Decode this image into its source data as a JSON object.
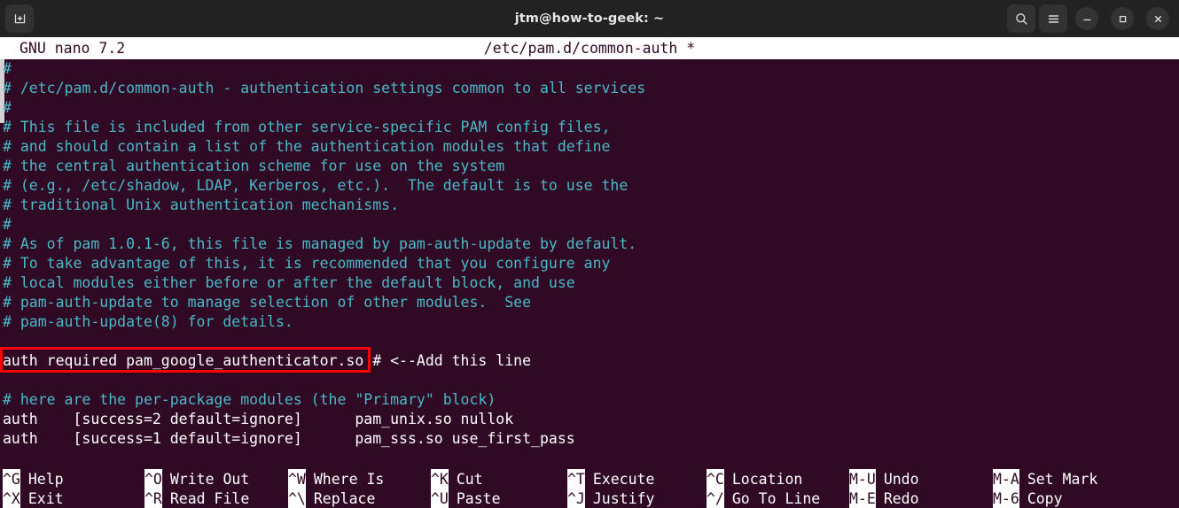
{
  "titlebar": {
    "title": "jtm@how-to-geek: ~",
    "new_tab_icon": "new-tab-icon",
    "search_icon": "search-icon",
    "menu_icon": "hamburger-menu-icon",
    "minimize_icon": "minimize-icon",
    "maximize_icon": "maximize-icon",
    "close_icon": "close-icon",
    "bg_color": "#222222"
  },
  "nano": {
    "version": "GNU nano 7.2",
    "filename": "/etc/pam.d/common-auth *",
    "header_bg": "#ffffff",
    "header_fg": "#300a24",
    "terminal_bg": "#300a24",
    "comment_color": "#48b9c7",
    "text_color": "#ffffff"
  },
  "editor": {
    "lines": [
      {
        "segments": [
          {
            "text": "#",
            "kind": "cmt"
          }
        ]
      },
      {
        "segments": [
          {
            "text": "# /etc/pam.d/common-auth - authentication settings common to all services",
            "kind": "cmt"
          }
        ]
      },
      {
        "segments": [
          {
            "text": "#",
            "kind": "cmt"
          }
        ]
      },
      {
        "segments": [
          {
            "text": "# This file is included from other service-specific PAM config files,",
            "kind": "cmt"
          }
        ]
      },
      {
        "segments": [
          {
            "text": "# and should contain a list of the authentication modules that define",
            "kind": "cmt"
          }
        ]
      },
      {
        "segments": [
          {
            "text": "# the central authentication scheme for use on the system",
            "kind": "cmt"
          }
        ]
      },
      {
        "segments": [
          {
            "text": "# (e.g., /etc/shadow, LDAP, Kerberos, etc.).  The default is to use the",
            "kind": "cmt"
          }
        ]
      },
      {
        "segments": [
          {
            "text": "# traditional Unix authentication mechanisms.",
            "kind": "cmt"
          }
        ]
      },
      {
        "segments": [
          {
            "text": "#",
            "kind": "cmt"
          }
        ]
      },
      {
        "segments": [
          {
            "text": "# As of pam 1.0.1-6, this file is managed by pam-auth-update by default.",
            "kind": "cmt"
          }
        ]
      },
      {
        "segments": [
          {
            "text": "# To take advantage of this, it is recommended that you configure any",
            "kind": "cmt"
          }
        ]
      },
      {
        "segments": [
          {
            "text": "# local modules either before or after the default block, and use",
            "kind": "cmt"
          }
        ]
      },
      {
        "segments": [
          {
            "text": "# pam-auth-update to manage selection of other modules.  See",
            "kind": "cmt"
          }
        ]
      },
      {
        "segments": [
          {
            "text": "# pam-auth-update(8) for details.",
            "kind": "cmt"
          }
        ]
      },
      {
        "segments": [
          {
            "text": "",
            "kind": "txt"
          }
        ]
      },
      {
        "segments": [
          {
            "text": "auth required pam_google_authenticator.so # <--Add this line",
            "kind": "txt"
          }
        ]
      },
      {
        "segments": [
          {
            "text": "",
            "kind": "txt"
          }
        ]
      },
      {
        "segments": [
          {
            "text": "# here are the per-package modules (the \"Primary\" block)",
            "kind": "cmt"
          }
        ]
      },
      {
        "segments": [
          {
            "text": "auth    [success=2 default=ignore]      pam_unix.so nullok",
            "kind": "txt"
          }
        ]
      },
      {
        "segments": [
          {
            "text": "auth    [success=1 default=ignore]      pam_sss.so use_first_pass",
            "kind": "txt"
          }
        ]
      }
    ]
  },
  "annotation": {
    "highlight_color": "#fe0000",
    "highlighted_text": "auth required pam_google_authenticator.so",
    "note_text": "# <--Add this line"
  },
  "footer": {
    "shortcuts_row1": [
      {
        "key": "^G",
        "label": "Help"
      },
      {
        "key": "^O",
        "label": "Write Out"
      },
      {
        "key": "^W",
        "label": "Where Is"
      },
      {
        "key": "^K",
        "label": "Cut"
      },
      {
        "key": "^T",
        "label": "Execute"
      },
      {
        "key": "^C",
        "label": "Location"
      },
      {
        "key": "M-U",
        "label": "Undo"
      },
      {
        "key": "M-A",
        "label": "Set Mark"
      }
    ],
    "shortcuts_row2": [
      {
        "key": "^X",
        "label": "Exit"
      },
      {
        "key": "^R",
        "label": "Read File"
      },
      {
        "key": "^\\",
        "label": "Replace"
      },
      {
        "key": "^U",
        "label": "Paste"
      },
      {
        "key": "^J",
        "label": "Justify"
      },
      {
        "key": "^/",
        "label": "Go To Line"
      },
      {
        "key": "M-E",
        "label": "Redo"
      },
      {
        "key": "M-6",
        "label": "Copy"
      }
    ]
  }
}
